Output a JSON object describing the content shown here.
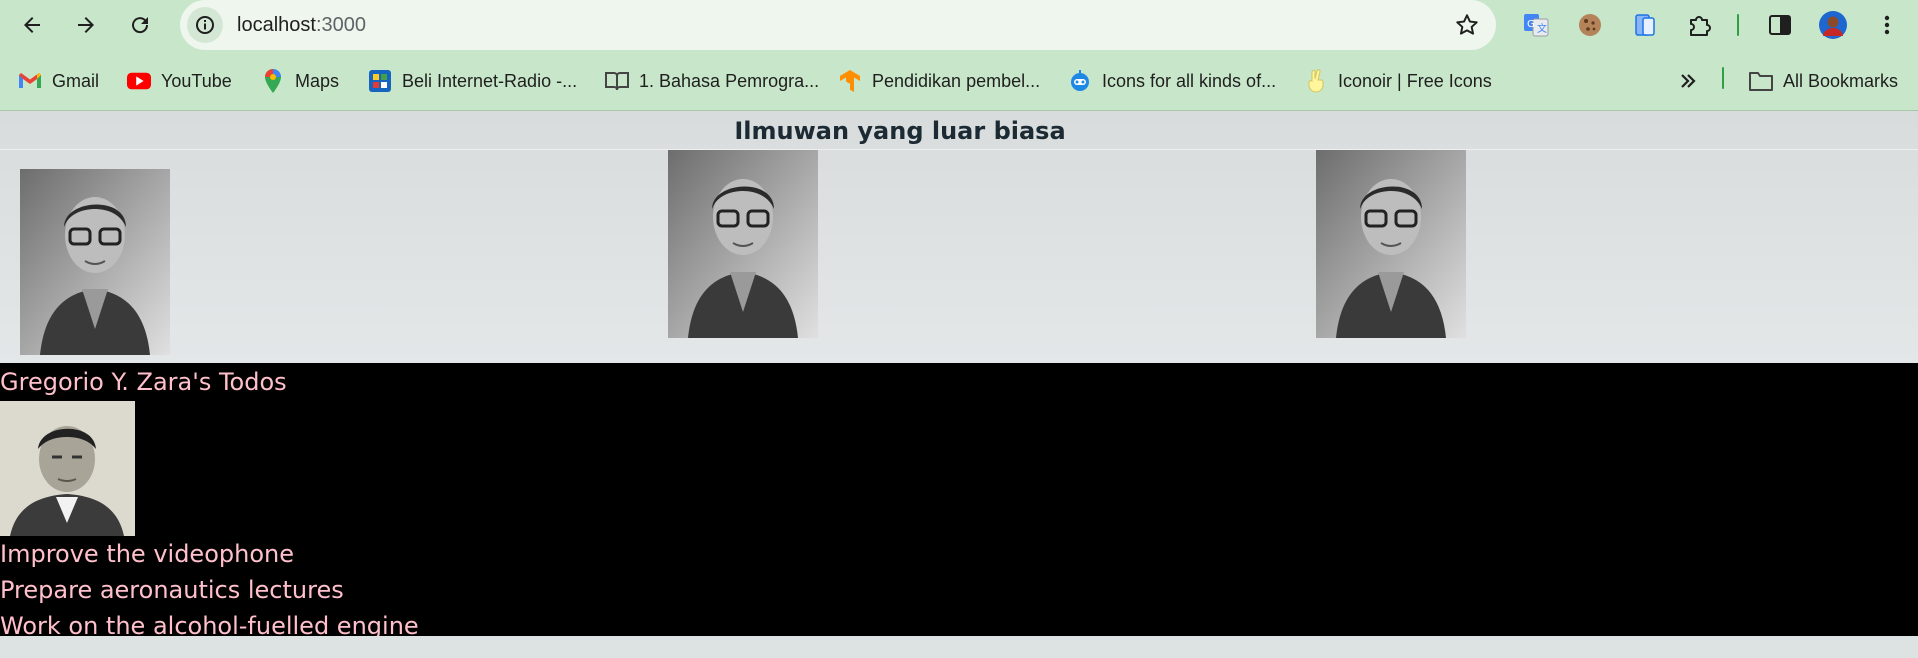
{
  "browser": {
    "url_host": "localhost",
    "url_port": ":3000",
    "bookmarks": [
      {
        "label": "Gmail",
        "icon": "gmail-icon"
      },
      {
        "label": "YouTube",
        "icon": "youtube-icon"
      },
      {
        "label": "Maps",
        "icon": "maps-icon"
      },
      {
        "label": "Beli Internet-Radio -...",
        "icon": "radio-icon"
      },
      {
        "label": "1. Bahasa Pemrogra...",
        "icon": "book-icon"
      },
      {
        "label": "Pendidikan pembel...",
        "icon": "tensorflow-icon"
      },
      {
        "label": "Icons for all kinds of...",
        "icon": "robot-icon"
      },
      {
        "label": "Iconoir | Free Icons",
        "icon": "peace-hand-icon"
      }
    ],
    "all_bookmarks_label": "All Bookmarks"
  },
  "gallery": {
    "title": "Ilmuwan yang luar biasa"
  },
  "todos": {
    "title": "Gregorio Y. Zara's Todos",
    "items": [
      "Improve the videophone",
      "Prepare aeronautics lectures",
      "Work on the alcohol-fuelled engine"
    ]
  },
  "colors": {
    "chrome_green": "#c8e6c9",
    "todo_text": "#ffc0cb",
    "todo_bg": "#000000"
  }
}
